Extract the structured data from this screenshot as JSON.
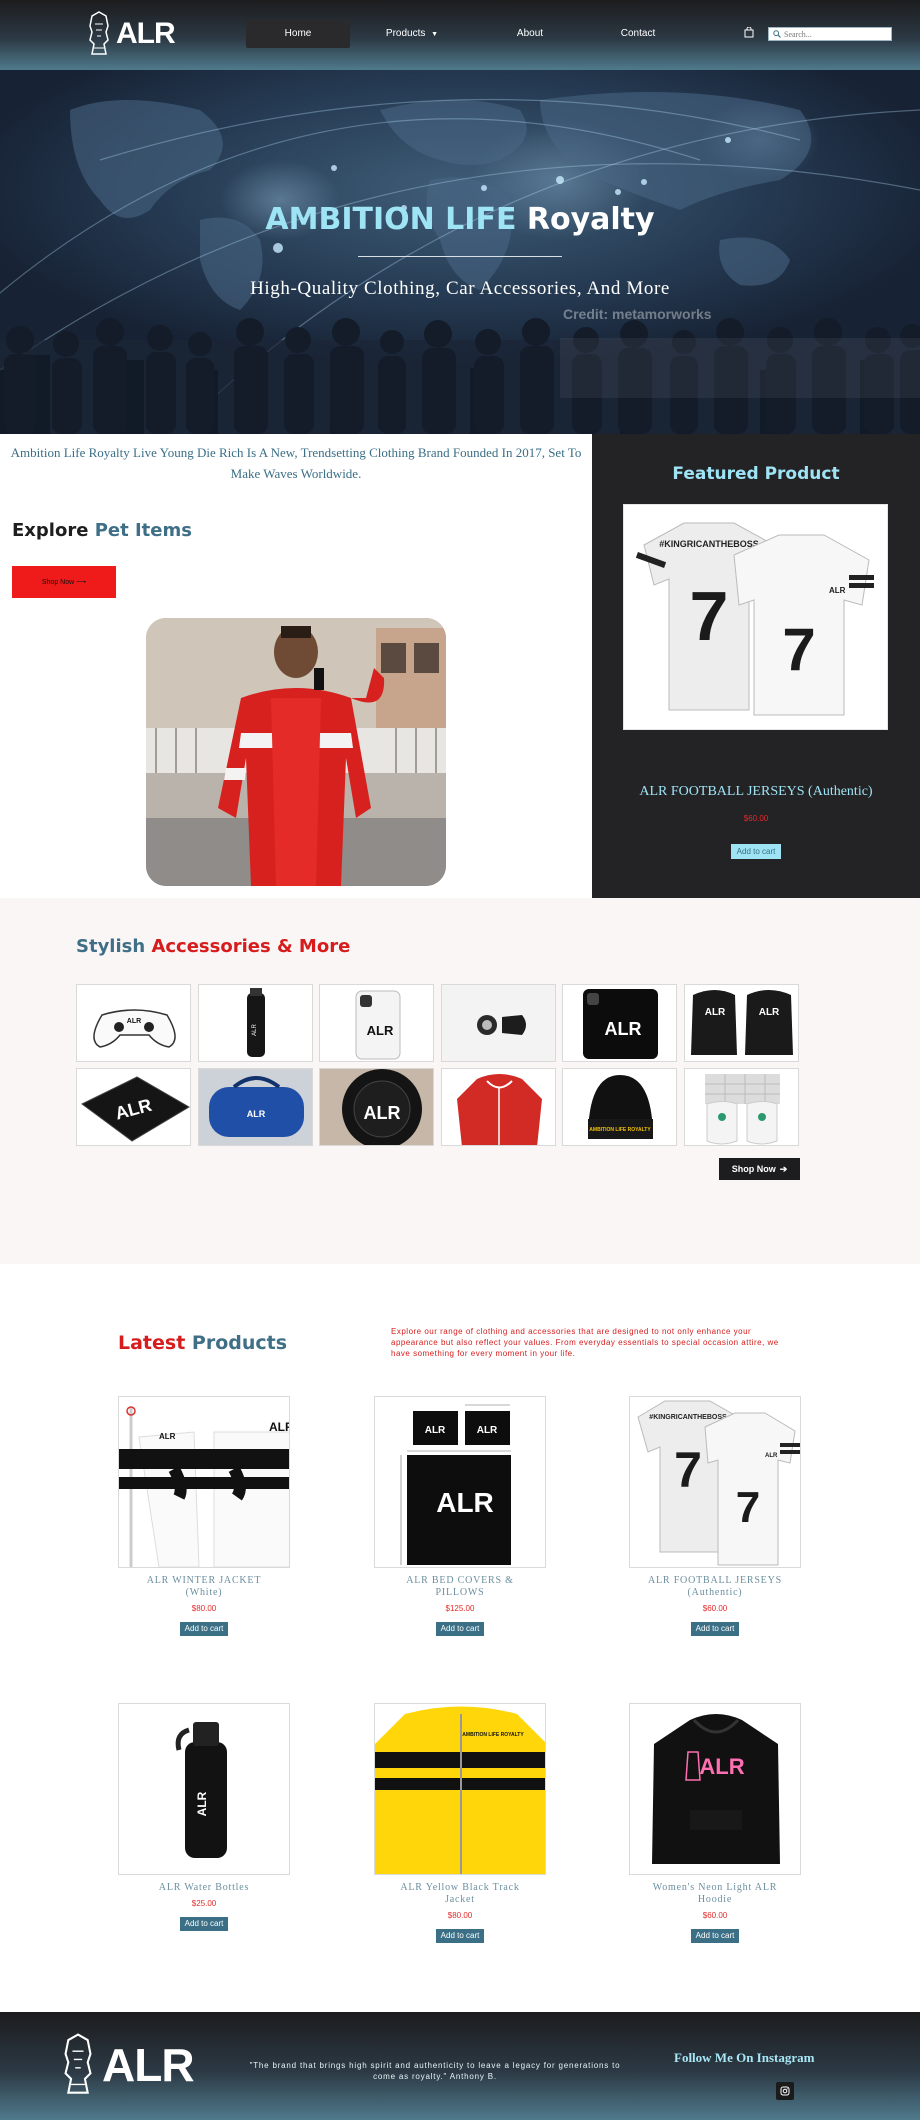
{
  "brand": {
    "logo_text": "ALR"
  },
  "nav": {
    "items": [
      {
        "label": "Home",
        "active": true
      },
      {
        "label": "Products",
        "has_dropdown": true
      },
      {
        "label": "About"
      },
      {
        "label": "Contact"
      }
    ],
    "search_placeholder": "Search..."
  },
  "hero": {
    "title_accent": "AMBITION LIFE",
    "title_main": "Royalty",
    "subtitle": "High-Quality Clothing, Car Accessories, And More",
    "credit": "Credit: metamorworks"
  },
  "intro": {
    "text": "Ambition Life Royalty Live Young Die Rich Is A New, Trendsetting Clothing Brand Founded In 2017, Set To Make Waves Worldwide."
  },
  "explore": {
    "title_main": "Explore",
    "title_accent": "Pet Items",
    "button_label": "Shop Now ⟶"
  },
  "featured": {
    "title": "Featured Product",
    "product_name": "ALR FOOTBALL JERSEYS (Authentic)",
    "price": "$60.00",
    "cart_label": "Add to cart"
  },
  "accessories": {
    "title_main": "Stylish",
    "title_accent": "Accessories & More",
    "button_label": "Shop Now",
    "tiles": [
      "game-controller",
      "water-bottle",
      "phone-case",
      "car-mount",
      "phone-case-black",
      "car-seat-covers",
      "mouse-pad",
      "duffel-bag",
      "tire-cover",
      "red-hoodie",
      "beanie",
      "slides"
    ]
  },
  "latest": {
    "title_accent": "Latest",
    "title_main": "Products",
    "description": "Explore our range of clothing and accessories that are designed to not only enhance your appearance but also reflect your values. From everyday essentials to special occasion attire, we have something for every moment in your life.",
    "products": [
      {
        "name": "ALR WINTER JACKET (White)",
        "price": "$80.00",
        "cart_label": "Add to cart"
      },
      {
        "name": "ALR BED COVERS & PILLOWS",
        "price": "$125.00",
        "cart_label": "Add to cart"
      },
      {
        "name": "ALR FOOTBALL JERSEYS (Authentic)",
        "price": "$60.00",
        "cart_label": "Add to cart"
      },
      {
        "name": "ALR Water Bottles",
        "price": "$25.00",
        "cart_label": "Add to cart"
      },
      {
        "name": "ALR Yellow Black Track Jacket",
        "price": "$80.00",
        "cart_label": "Add to cart"
      },
      {
        "name": "Women's Neon Light ALR Hoodie",
        "price": "$60.00",
        "cart_label": "Add to cart"
      }
    ],
    "jersey_text": "#KINGRICANTHEBOSS",
    "jacket_text": "AMBITION LIFE ROYALTY"
  },
  "footer": {
    "quote": "\"The brand that brings high spirit and authenticity to leave a legacy for generations to come as royalty.\" Anthony B.",
    "follow_label": "Follow Me On Instagram"
  }
}
